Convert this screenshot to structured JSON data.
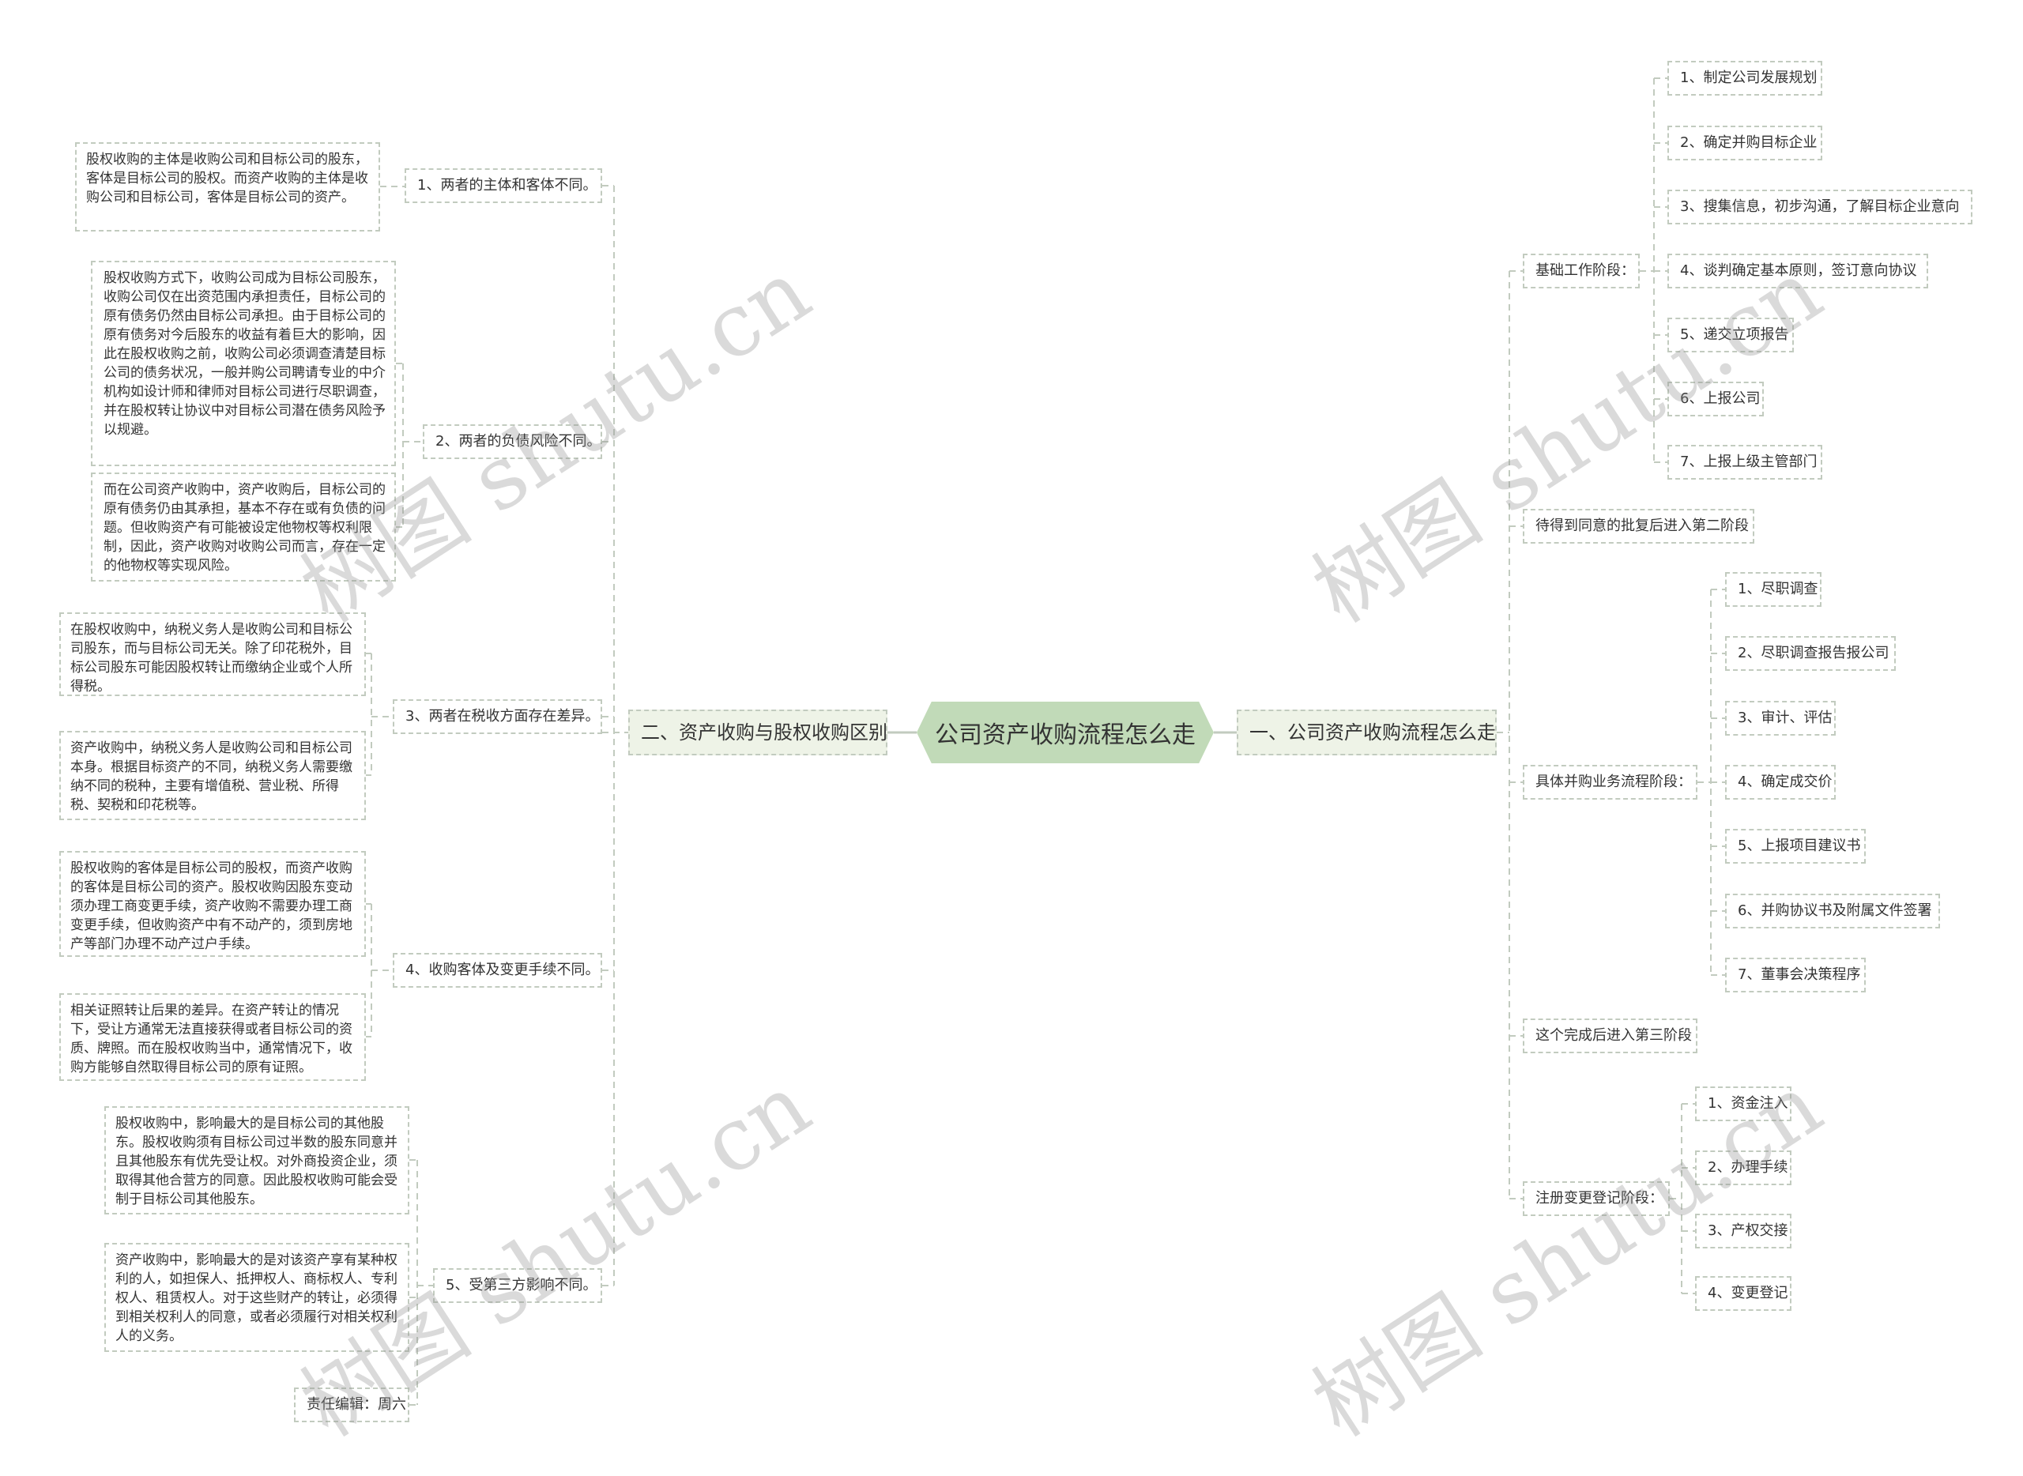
{
  "root": {
    "title": "公司资产收购流程怎么走"
  },
  "left_branch": {
    "title": "二、资产收购与股权收购区别",
    "items": [
      {
        "label": "1、两者的主体和客体不同。",
        "details": [
          "股权收购的主体是收购公司和目标公司的股东，客体是目标公司的股权。而资产收购的主体是收购公司和目标公司，客体是目标公司的资产。"
        ]
      },
      {
        "label": "2、两者的负债风险不同。",
        "details": [
          "股权收购方式下，收购公司成为目标公司股东，收购公司仅在出资范围内承担责任，目标公司的原有债务仍然由目标公司承担。由于目标公司的原有债务对今后股东的收益有着巨大的影响，因此在股权收购之前，收购公司必须调查清楚目标公司的债务状况，一般并购公司聘请专业的中介机构如设计师和律师对目标公司进行尽职调查，并在股权转让协议中对目标公司潜在债务风险予以规避。",
          "而在公司资产收购中，资产收购后，目标公司的原有债务仍由其承担，基本不存在或有负债的问题。但收购资产有可能被设定他物权等权利限制，因此，资产收购对收购公司而言，存在一定的他物权等实现风险。"
        ]
      },
      {
        "label": "3、两者在税收方面存在差异。",
        "details": [
          "在股权收购中，纳税义务人是收购公司和目标公司股东，而与目标公司无关。除了印花税外，目标公司股东可能因股权转让而缴纳企业或个人所得税。",
          "资产收购中，纳税义务人是收购公司和目标公司本身。根据目标资产的不同，纳税义务人需要缴纳不同的税种，主要有增值税、营业税、所得税、契税和印花税等。"
        ]
      },
      {
        "label": "4、收购客体及变更手续不同。",
        "details": [
          "股权收购的客体是目标公司的股权，而资产收购的客体是目标公司的资产。股权收购因股东变动须办理工商变更手续，资产收购不需要办理工商变更手续，但收购资产中有不动产的，须到房地产等部门办理不动产过户手续。",
          "相关证照转让后果的差异。在资产转让的情况下，受让方通常无法直接获得或者目标公司的资质、牌照。而在股权收购当中，通常情况下，收购方能够自然取得目标公司的原有证照。"
        ]
      },
      {
        "label": "5、受第三方影响不同。",
        "details": [
          "股权收购中，影响最大的是目标公司的其他股东。股权收购须有目标公司过半数的股东同意并且其他股东有优先受让权。对外商投资企业，须取得其他合营方的同意。因此股权收购可能会受制于目标公司其他股东。",
          "资产收购中，影响最大的是对该资产享有某种权利的人，如担保人、抵押权人、商标权人、专利权人、租赁权人。对于这些财产的转让，必须得到相关权利人的同意，或者必须履行对相关权利人的义务。",
          "责任编辑：周六"
        ]
      }
    ]
  },
  "right_branch": {
    "title": "一、公司资产收购流程怎么走",
    "items": [
      {
        "label": "基础工作阶段：",
        "children": [
          "1、制定公司发展规划",
          "2、确定并购目标企业",
          "3、搜集信息，初步沟通，了解目标企业意向",
          "4、谈判确定基本原则，签订意向协议",
          "5、递交立项报告",
          "6、上报公司",
          "7、上报上级主管部门"
        ]
      },
      {
        "label": "待得到同意的批复后进入第二阶段",
        "children": []
      },
      {
        "label": "具体并购业务流程阶段：",
        "children": [
          "1、尽职调查",
          "2、尽职调查报告报公司",
          "3、审计、评估",
          "4、确定成交价",
          "5、上报项目建议书",
          "6、并购协议书及附属文件签署",
          "7、董事会决策程序"
        ]
      },
      {
        "label": "这个完成后进入第三阶段",
        "children": []
      },
      {
        "label": "注册变更登记阶段：",
        "children": [
          "1、资金注入",
          "2、办理手续",
          "3、产权交接",
          "4、变更登记"
        ]
      }
    ]
  },
  "watermark": {
    "text": "树图 shutu.cn"
  },
  "colors": {
    "root_fill": "#c1dab8",
    "branch_fill": "#eef3e7",
    "border": "#c2cbbf",
    "line": "#c2cbbf",
    "text": "#333333"
  }
}
